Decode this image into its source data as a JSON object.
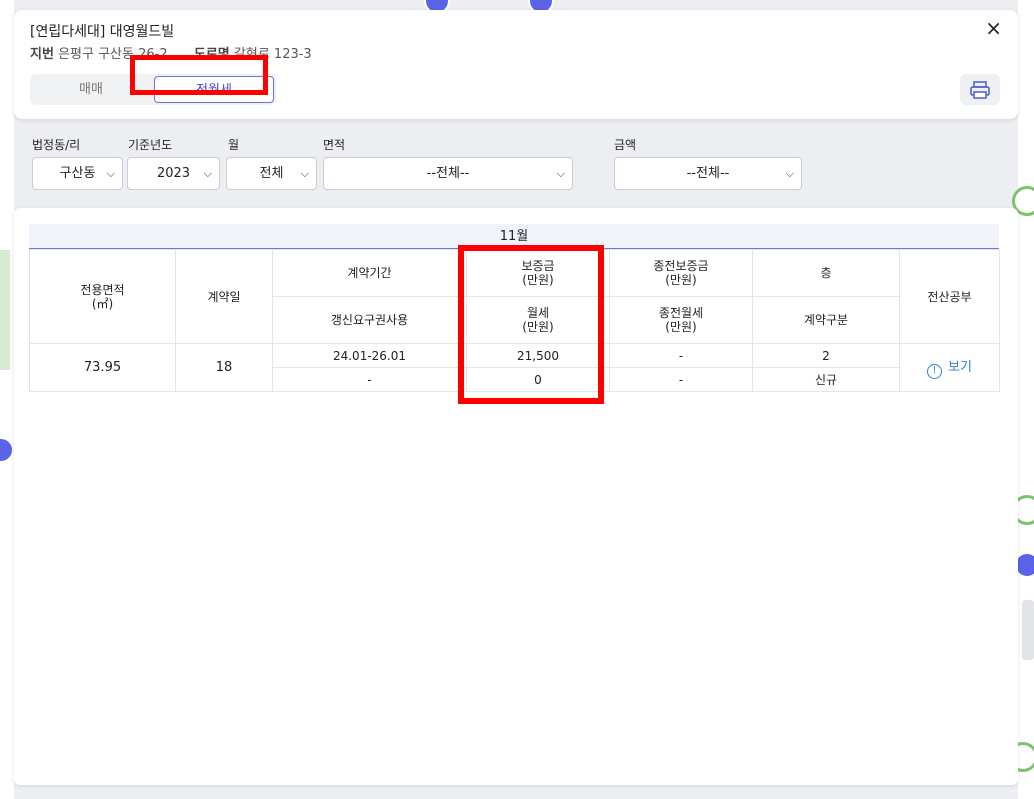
{
  "header": {
    "title": "[연립다세대] 대영월드빌",
    "jibun_label": "지번",
    "jibun_value": "은평구 구산동 26-2",
    "road_label": "도로명",
    "road_value": "갈현로 123-3",
    "close_icon": "×",
    "tabs": [
      {
        "label": "매매",
        "active": false
      },
      {
        "label": "전월세",
        "active": true
      }
    ],
    "print_icon": "printer-icon"
  },
  "filters": {
    "dong": {
      "label": "법정동/리",
      "value": "구산동"
    },
    "year": {
      "label": "기준년도",
      "value": "2023"
    },
    "month": {
      "label": "월",
      "value": "전체"
    },
    "area": {
      "label": "면적",
      "value": "--전체--"
    },
    "amount": {
      "label": "금액",
      "value": "--전체--"
    }
  },
  "table": {
    "month_title": "11월",
    "headers": {
      "area": "전용면적\n(㎡)",
      "contract_day": "계약일",
      "contract_period": "계약기간",
      "renewal": "갱신요구권사용",
      "deposit": "보증금\n(만원)",
      "monthly": "월세\n(만원)",
      "prev_deposit": "종전보증금\n(만원)",
      "prev_monthly": "종전월세\n(만원)",
      "floor": "층",
      "contract_type": "계약구분",
      "registry": "전산공부"
    },
    "rows": [
      {
        "area": "73.95",
        "day": "18",
        "period": "24.01-26.01",
        "renewal": "-",
        "deposit": "21,500",
        "monthly": "0",
        "prev_deposit": "-",
        "prev_monthly": "-",
        "floor": "2",
        "contract_type": "신규",
        "view_label": "보기"
      }
    ]
  },
  "colors": {
    "accent": "#3e48d6",
    "highlight": "#ff0000",
    "link": "#2f7fd8"
  }
}
